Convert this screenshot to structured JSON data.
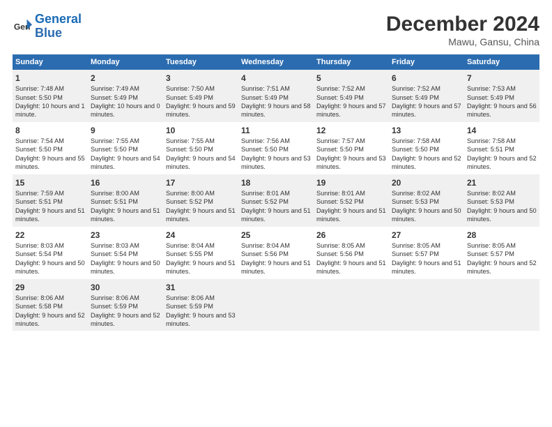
{
  "logo": {
    "line1": "General",
    "line2": "Blue"
  },
  "title": "December 2024",
  "subtitle": "Mawu, Gansu, China",
  "days_of_week": [
    "Sunday",
    "Monday",
    "Tuesday",
    "Wednesday",
    "Thursday",
    "Friday",
    "Saturday"
  ],
  "weeks": [
    [
      {
        "day": "1",
        "sunrise": "Sunrise: 7:48 AM",
        "sunset": "Sunset: 5:50 PM",
        "daylight": "Daylight: 10 hours and 1 minute."
      },
      {
        "day": "2",
        "sunrise": "Sunrise: 7:49 AM",
        "sunset": "Sunset: 5:49 PM",
        "daylight": "Daylight: 10 hours and 0 minutes."
      },
      {
        "day": "3",
        "sunrise": "Sunrise: 7:50 AM",
        "sunset": "Sunset: 5:49 PM",
        "daylight": "Daylight: 9 hours and 59 minutes."
      },
      {
        "day": "4",
        "sunrise": "Sunrise: 7:51 AM",
        "sunset": "Sunset: 5:49 PM",
        "daylight": "Daylight: 9 hours and 58 minutes."
      },
      {
        "day": "5",
        "sunrise": "Sunrise: 7:52 AM",
        "sunset": "Sunset: 5:49 PM",
        "daylight": "Daylight: 9 hours and 57 minutes."
      },
      {
        "day": "6",
        "sunrise": "Sunrise: 7:52 AM",
        "sunset": "Sunset: 5:49 PM",
        "daylight": "Daylight: 9 hours and 57 minutes."
      },
      {
        "day": "7",
        "sunrise": "Sunrise: 7:53 AM",
        "sunset": "Sunset: 5:49 PM",
        "daylight": "Daylight: 9 hours and 56 minutes."
      }
    ],
    [
      {
        "day": "8",
        "sunrise": "Sunrise: 7:54 AM",
        "sunset": "Sunset: 5:50 PM",
        "daylight": "Daylight: 9 hours and 55 minutes."
      },
      {
        "day": "9",
        "sunrise": "Sunrise: 7:55 AM",
        "sunset": "Sunset: 5:50 PM",
        "daylight": "Daylight: 9 hours and 54 minutes."
      },
      {
        "day": "10",
        "sunrise": "Sunrise: 7:55 AM",
        "sunset": "Sunset: 5:50 PM",
        "daylight": "Daylight: 9 hours and 54 minutes."
      },
      {
        "day": "11",
        "sunrise": "Sunrise: 7:56 AM",
        "sunset": "Sunset: 5:50 PM",
        "daylight": "Daylight: 9 hours and 53 minutes."
      },
      {
        "day": "12",
        "sunrise": "Sunrise: 7:57 AM",
        "sunset": "Sunset: 5:50 PM",
        "daylight": "Daylight: 9 hours and 53 minutes."
      },
      {
        "day": "13",
        "sunrise": "Sunrise: 7:58 AM",
        "sunset": "Sunset: 5:50 PM",
        "daylight": "Daylight: 9 hours and 52 minutes."
      },
      {
        "day": "14",
        "sunrise": "Sunrise: 7:58 AM",
        "sunset": "Sunset: 5:51 PM",
        "daylight": "Daylight: 9 hours and 52 minutes."
      }
    ],
    [
      {
        "day": "15",
        "sunrise": "Sunrise: 7:59 AM",
        "sunset": "Sunset: 5:51 PM",
        "daylight": "Daylight: 9 hours and 51 minutes."
      },
      {
        "day": "16",
        "sunrise": "Sunrise: 8:00 AM",
        "sunset": "Sunset: 5:51 PM",
        "daylight": "Daylight: 9 hours and 51 minutes."
      },
      {
        "day": "17",
        "sunrise": "Sunrise: 8:00 AM",
        "sunset": "Sunset: 5:52 PM",
        "daylight": "Daylight: 9 hours and 51 minutes."
      },
      {
        "day": "18",
        "sunrise": "Sunrise: 8:01 AM",
        "sunset": "Sunset: 5:52 PM",
        "daylight": "Daylight: 9 hours and 51 minutes."
      },
      {
        "day": "19",
        "sunrise": "Sunrise: 8:01 AM",
        "sunset": "Sunset: 5:52 PM",
        "daylight": "Daylight: 9 hours and 51 minutes."
      },
      {
        "day": "20",
        "sunrise": "Sunrise: 8:02 AM",
        "sunset": "Sunset: 5:53 PM",
        "daylight": "Daylight: 9 hours and 50 minutes."
      },
      {
        "day": "21",
        "sunrise": "Sunrise: 8:02 AM",
        "sunset": "Sunset: 5:53 PM",
        "daylight": "Daylight: 9 hours and 50 minutes."
      }
    ],
    [
      {
        "day": "22",
        "sunrise": "Sunrise: 8:03 AM",
        "sunset": "Sunset: 5:54 PM",
        "daylight": "Daylight: 9 hours and 50 minutes."
      },
      {
        "day": "23",
        "sunrise": "Sunrise: 8:03 AM",
        "sunset": "Sunset: 5:54 PM",
        "daylight": "Daylight: 9 hours and 50 minutes."
      },
      {
        "day": "24",
        "sunrise": "Sunrise: 8:04 AM",
        "sunset": "Sunset: 5:55 PM",
        "daylight": "Daylight: 9 hours and 51 minutes."
      },
      {
        "day": "25",
        "sunrise": "Sunrise: 8:04 AM",
        "sunset": "Sunset: 5:56 PM",
        "daylight": "Daylight: 9 hours and 51 minutes."
      },
      {
        "day": "26",
        "sunrise": "Sunrise: 8:05 AM",
        "sunset": "Sunset: 5:56 PM",
        "daylight": "Daylight: 9 hours and 51 minutes."
      },
      {
        "day": "27",
        "sunrise": "Sunrise: 8:05 AM",
        "sunset": "Sunset: 5:57 PM",
        "daylight": "Daylight: 9 hours and 51 minutes."
      },
      {
        "day": "28",
        "sunrise": "Sunrise: 8:05 AM",
        "sunset": "Sunset: 5:57 PM",
        "daylight": "Daylight: 9 hours and 52 minutes."
      }
    ],
    [
      {
        "day": "29",
        "sunrise": "Sunrise: 8:06 AM",
        "sunset": "Sunset: 5:58 PM",
        "daylight": "Daylight: 9 hours and 52 minutes."
      },
      {
        "day": "30",
        "sunrise": "Sunrise: 8:06 AM",
        "sunset": "Sunset: 5:59 PM",
        "daylight": "Daylight: 9 hours and 52 minutes."
      },
      {
        "day": "31",
        "sunrise": "Sunrise: 8:06 AM",
        "sunset": "Sunset: 5:59 PM",
        "daylight": "Daylight: 9 hours and 53 minutes."
      },
      null,
      null,
      null,
      null
    ]
  ]
}
